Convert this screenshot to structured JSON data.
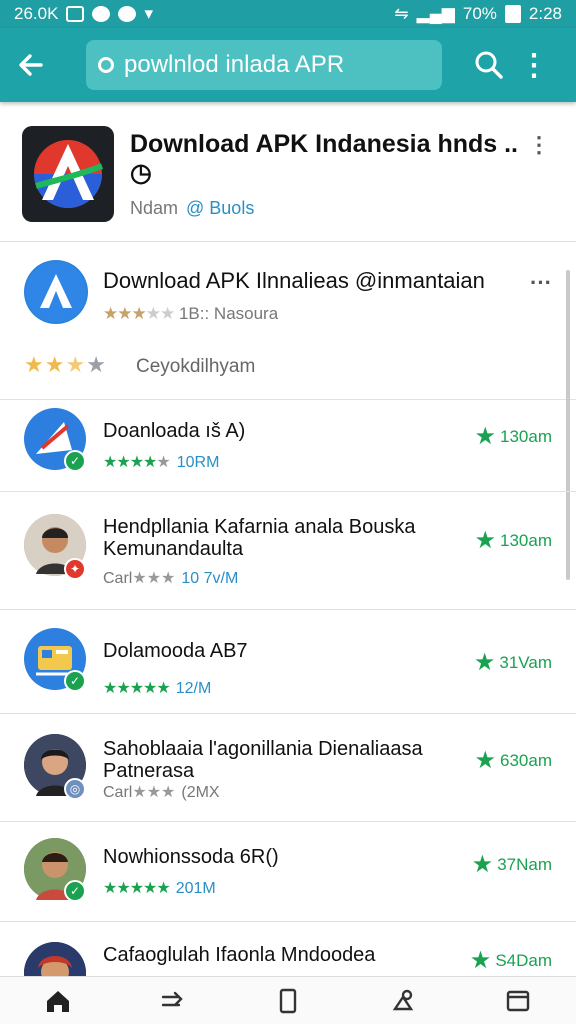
{
  "status": {
    "time_left": "26.0K",
    "battery": "70%",
    "time_right": "2:28"
  },
  "search": {
    "query": "powlnlod inlada APR"
  },
  "top": {
    "title": "Download APK Indanesia hnds .. ◷",
    "sub": "Ndam",
    "sub_link": "@ Buols"
  },
  "featured": {
    "name": "Download APK Ilnnalieas @inmantaian",
    "stars": "★★★",
    "stars_empty": "★★",
    "meta": "1B:: Nasoura",
    "rating_full": "★★",
    "rating_half": "★",
    "rating_empty": "★",
    "developer": "Ceyokdilhyam"
  },
  "apps": [
    {
      "name": "Doanloada ıš A)",
      "stars": "★★★★",
      "empty": "★",
      "prefix": "",
      "size": "10RM",
      "right": "130am"
    },
    {
      "name": "Hendpllania Kafarnia anala Bouska Kemunandaulta",
      "stars": "",
      "empty": "★★★",
      "prefix": "Carl",
      "size": "10 7v/M",
      "right": "130am"
    },
    {
      "name": "Dolamooda AB7",
      "stars": "★★★★★",
      "empty": "",
      "prefix": "",
      "size": "12/M",
      "right": "31Vam"
    },
    {
      "name": "Sahoblaaia l'agonillania Dienaliaasa Patnerasa",
      "stars": "",
      "empty": "★★★",
      "prefix": "Carl",
      "size": "(2MX",
      "right": "630am"
    },
    {
      "name": "Nowhionssoda 6R()",
      "stars": "★★★★★",
      "empty": "",
      "prefix": "",
      "size": "201M",
      "right": "37Nam"
    },
    {
      "name": "Cafaoglulah Ifaonla Mndoodea",
      "stars": "",
      "empty": "",
      "prefix": "",
      "size": "",
      "right": "S4Dam"
    }
  ],
  "colors": {
    "appbar": "#1ea4a8",
    "accent_green": "#1aa251",
    "link_blue": "#2a8fc6"
  },
  "icons": [
    "back-arrow-icon",
    "search-icon",
    "more-vert-icon",
    "home-icon",
    "forward-icon",
    "tablet-icon",
    "apps-icon",
    "window-icon"
  ]
}
